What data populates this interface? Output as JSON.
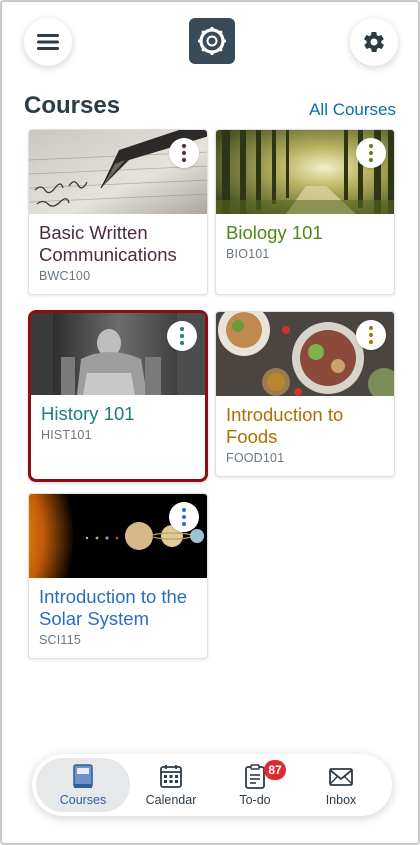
{
  "header": {
    "menu_icon": "hamburger-menu-icon",
    "logo_icon": "canvas-logo-icon",
    "settings_icon": "gear-icon"
  },
  "courses_section": {
    "title": "Courses",
    "all_link": "All Courses"
  },
  "courses": [
    {
      "name": "Basic Written Communications",
      "code": "BWC100",
      "color": "#4a2c43",
      "selected": false
    },
    {
      "name": "Biology 101",
      "code": "BIO101",
      "color": "#4e8a12",
      "selected": false
    },
    {
      "name": "History 101",
      "code": "HIST101",
      "color": "#1e7d78",
      "selected": true
    },
    {
      "name": "Introduction to Foods",
      "code": "FOOD101",
      "color": "#b06e00",
      "selected": false
    },
    {
      "name": "Introduction to the Solar System",
      "code": "SCI115",
      "color": "#2a6cc4",
      "selected": false
    }
  ],
  "tabbar": {
    "tabs": [
      {
        "label": "Courses",
        "icon": "book-icon",
        "active": true
      },
      {
        "label": "Calendar",
        "icon": "calendar-icon",
        "active": false
      },
      {
        "label": "To-do",
        "icon": "clipboard-icon",
        "active": false
      },
      {
        "label": "Inbox",
        "icon": "envelope-icon",
        "active": false
      }
    ],
    "todo_badge": "87"
  }
}
